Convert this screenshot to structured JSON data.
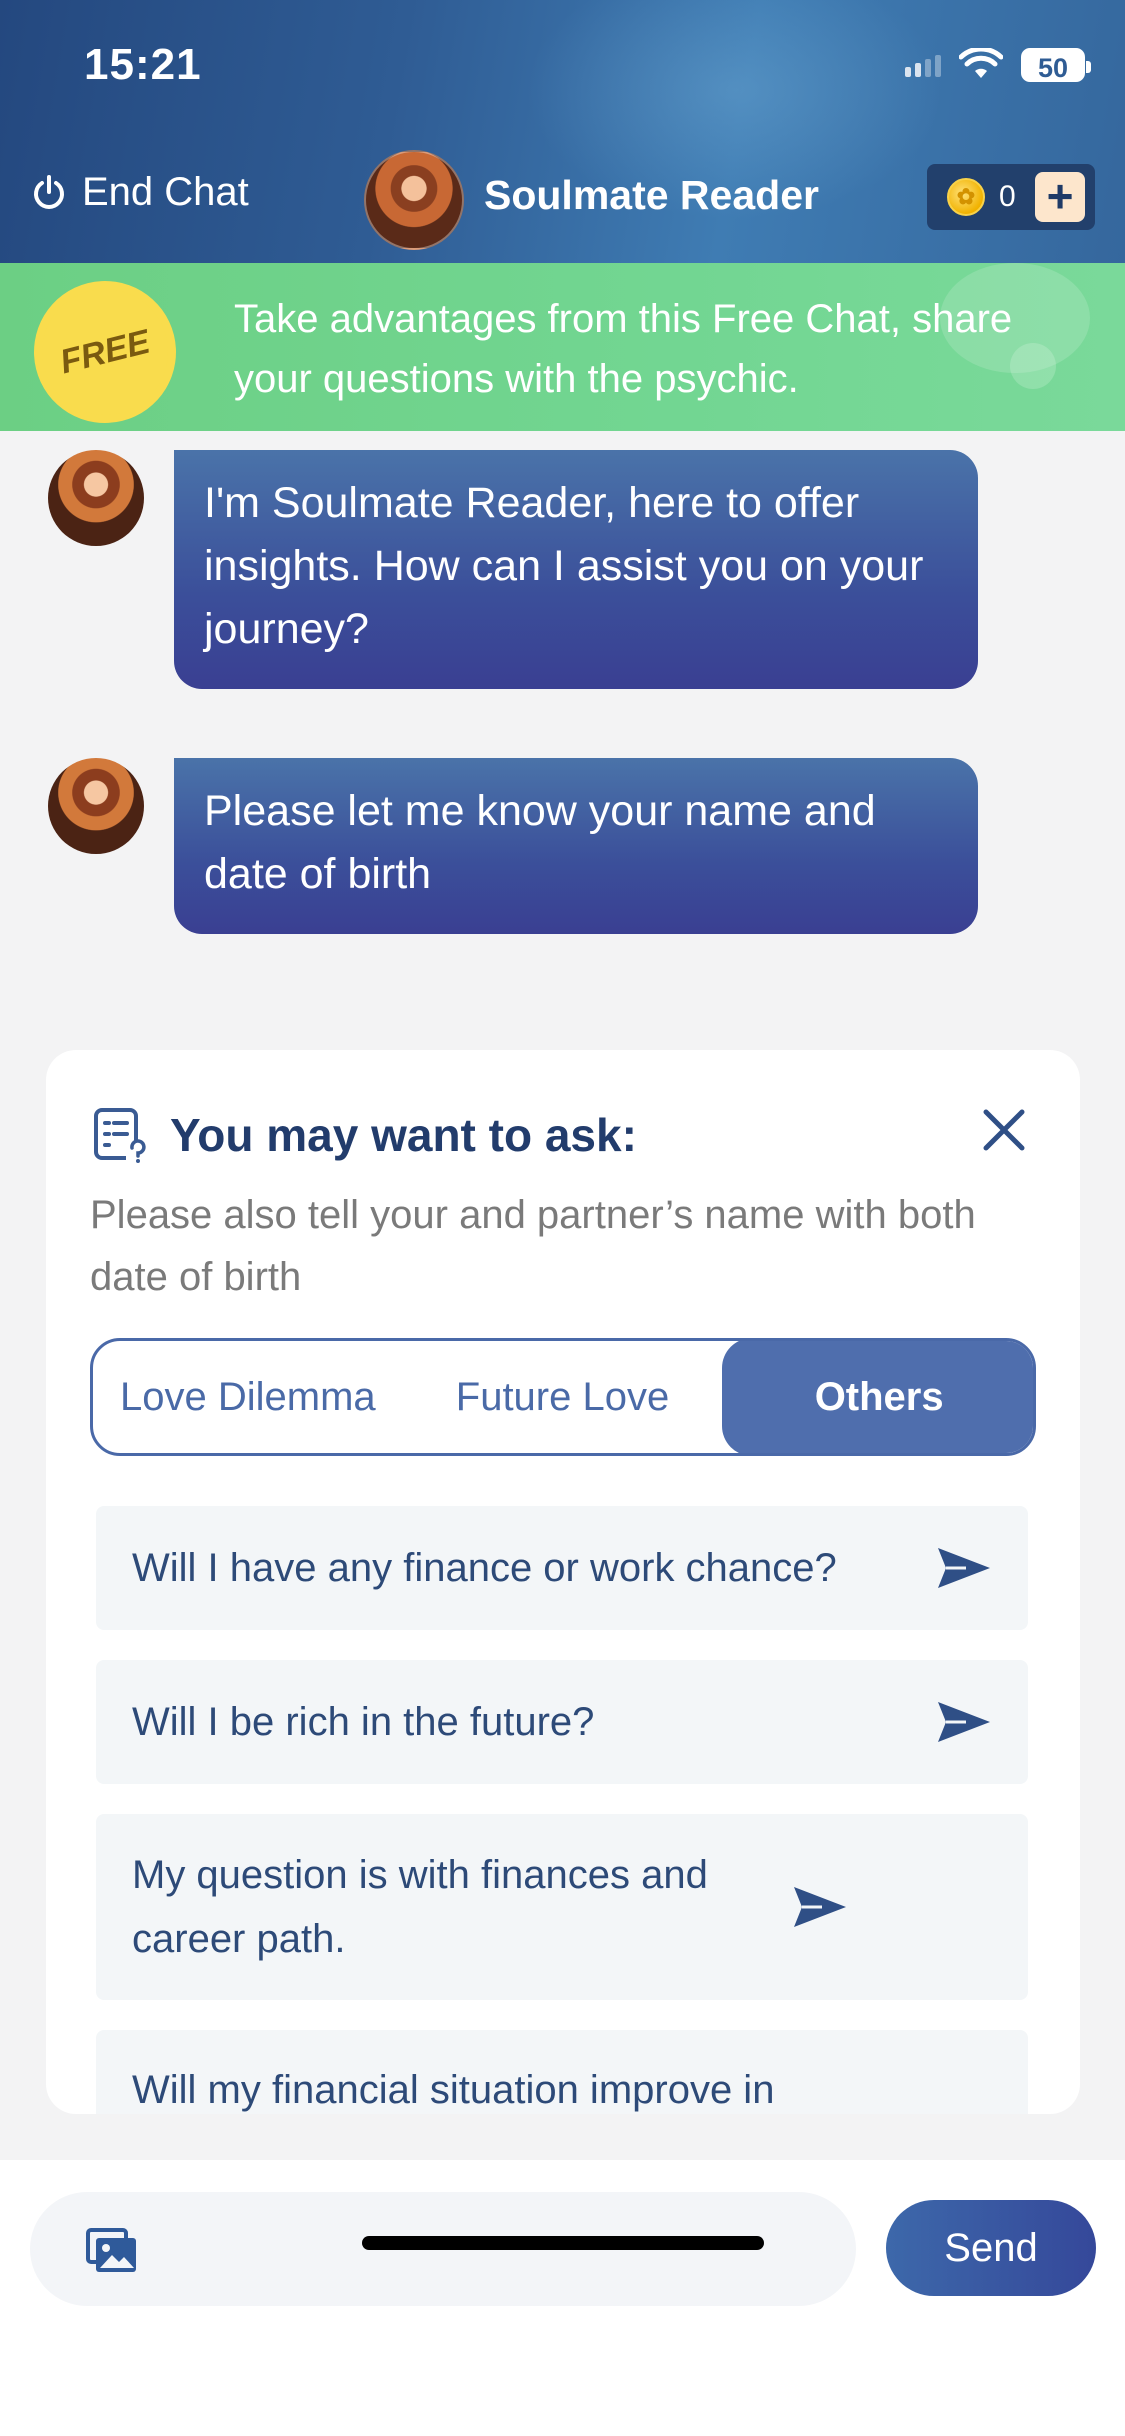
{
  "status_bar": {
    "time": "15:21",
    "battery": "50"
  },
  "header": {
    "end_chat_label": "End Chat",
    "reader_name": "Soulmate Reader",
    "coin_count": "0",
    "add_coins_label": "+"
  },
  "free_banner": {
    "badge": "FREE",
    "text": "Take advantages from this Free Chat, share your questions with the psychic."
  },
  "messages": [
    {
      "text": "I'm Soulmate Reader, here to offer insights. How can I assist you on your journey?"
    },
    {
      "text": "Please let me know your name and date of birth"
    }
  ],
  "suggestions": {
    "title": "You may want to ask:",
    "subtitle": "Please also tell your and partner’s name with both date of birth",
    "tabs": [
      "Love Dilemma",
      "Future Love",
      "Others"
    ],
    "selected_tab": "Others",
    "questions": [
      "Will I have any finance or work chance?",
      "Will I be rich in the future?",
      "My question is with finances and career path.",
      "Will my financial situation improve in"
    ]
  },
  "composer": {
    "send_label": "Send"
  },
  "colors": {
    "header_blue": "#2f5c94",
    "banner_green": "#72d692",
    "bubble_blue": "#3b4f9a",
    "accent": "#4f6ead",
    "title_navy": "#223c6c"
  }
}
